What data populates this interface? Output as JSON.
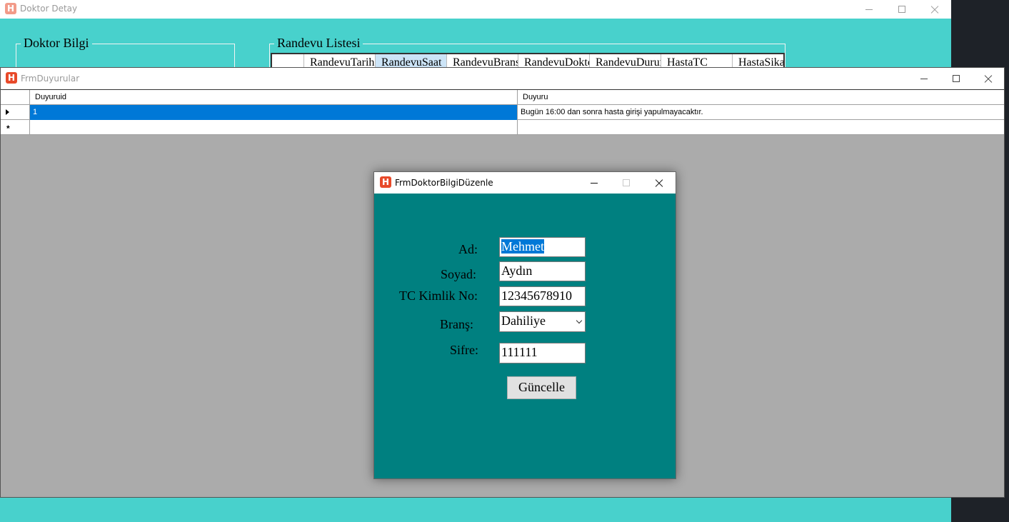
{
  "detay_window": {
    "title": "Doktor Detay",
    "groupbox_doktor": "Doktor Bilgi",
    "groupbox_randevu": "Randevu Listesi",
    "randevu_columns": [
      "RandevuTarih",
      "RandevuSaat",
      "RandevuBrans",
      "RandevuDoktor",
      "RandevuDurum",
      "HastaTC",
      "HastaSikayet"
    ]
  },
  "duyuru_window": {
    "title": "FrmDuyurular",
    "columns": [
      "Duyuruid",
      "Duyuru"
    ],
    "rows": [
      {
        "id": "1",
        "text": "Bugün 16:00 dan sonra hasta girişi yapulmayacaktır."
      }
    ],
    "new_row_marker": "*"
  },
  "edit_window": {
    "title": "FrmDoktorBilgiDüzenle",
    "fields": {
      "ad": {
        "label": "Ad:",
        "value": "Mehmet"
      },
      "soyad": {
        "label": "Soyad:",
        "value": "Aydın"
      },
      "tc": {
        "label": "TC Kimlik No:",
        "value": "12345678910"
      },
      "brans": {
        "label": "Branş:",
        "value": "Dahiliye"
      },
      "sifre": {
        "label": "Sifre:",
        "value": "111111"
      }
    },
    "update_button": "Güncelle"
  },
  "colors": {
    "detay_bg": "#48d1cc",
    "edit_bg": "#008080",
    "grid_selection": "#0078d7",
    "mdi_bg": "#ababab"
  },
  "icons": [
    "app-h-icon",
    "minimize-icon",
    "maximize-icon",
    "close-icon",
    "row-pointer-icon",
    "chevron-down-icon"
  ]
}
